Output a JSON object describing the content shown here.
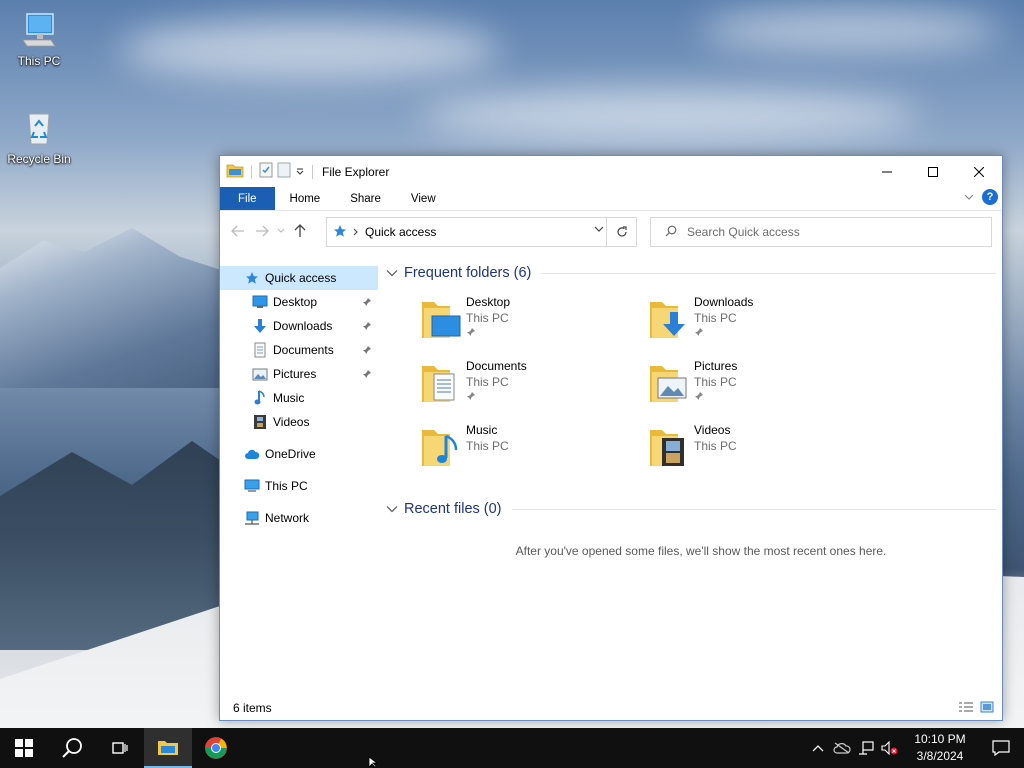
{
  "desktop": {
    "icons": [
      {
        "label": "This PC"
      },
      {
        "label": "Recycle Bin"
      }
    ]
  },
  "window": {
    "title": "File Explorer",
    "ribbon_tabs": [
      "File",
      "Home",
      "Share",
      "View"
    ],
    "address": {
      "location": "Quick access"
    },
    "search": {
      "placeholder": "Search Quick access"
    },
    "nav": {
      "quick_access": "Quick access",
      "pinned": [
        {
          "label": "Desktop",
          "pinned": true
        },
        {
          "label": "Downloads",
          "pinned": true
        },
        {
          "label": "Documents",
          "pinned": true
        },
        {
          "label": "Pictures",
          "pinned": true
        },
        {
          "label": "Music",
          "pinned": false
        },
        {
          "label": "Videos",
          "pinned": false
        }
      ],
      "onedrive": "OneDrive",
      "this_pc": "This PC",
      "network": "Network"
    },
    "frequent": {
      "header": "Frequent folders (6)",
      "folders": [
        {
          "name": "Desktop",
          "location": "This PC",
          "pinned": true,
          "icon": "desktop-folder-icon"
        },
        {
          "name": "Downloads",
          "location": "This PC",
          "pinned": true,
          "icon": "downloads-folder-icon"
        },
        {
          "name": "Documents",
          "location": "This PC",
          "pinned": true,
          "icon": "documents-folder-icon"
        },
        {
          "name": "Pictures",
          "location": "This PC",
          "pinned": true,
          "icon": "pictures-folder-icon"
        },
        {
          "name": "Music",
          "location": "This PC",
          "pinned": false,
          "icon": "music-folder-icon"
        },
        {
          "name": "Videos",
          "location": "This PC",
          "pinned": false,
          "icon": "videos-folder-icon"
        }
      ]
    },
    "recent": {
      "header": "Recent files (0)",
      "empty_message": "After you've opened some files, we'll show the most recent ones here."
    },
    "status": {
      "items": "6 items"
    }
  },
  "taskbar": {
    "clock_time": "10:10 PM",
    "clock_date": "3/8/2024"
  },
  "colors": {
    "accent": "#1a5fb4",
    "nav_selected": "#cce8ff",
    "group_header": "#1e3287"
  }
}
